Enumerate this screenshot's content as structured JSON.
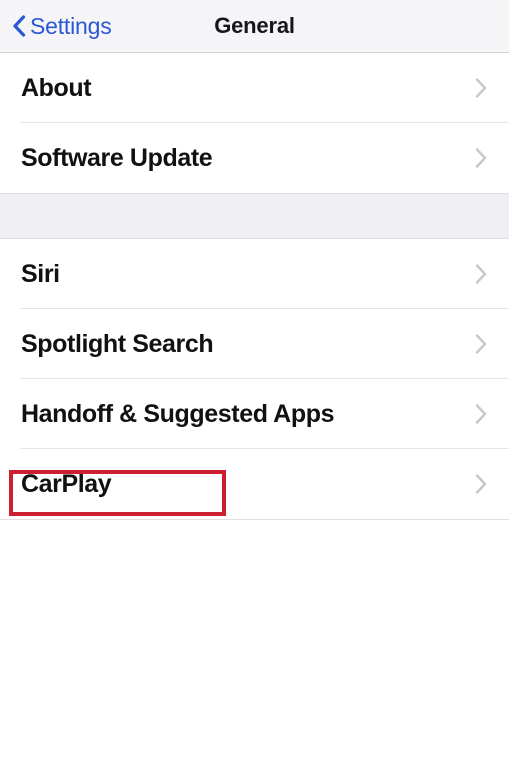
{
  "navbar": {
    "back_label": "Settings",
    "back_icon": "chevron-left-icon",
    "title": "General",
    "back_color": "#2B57D4",
    "background": "#F5F5F7"
  },
  "groups": [
    {
      "rows": [
        {
          "label": "About",
          "accessory": "chevron-right-icon"
        },
        {
          "label": "Software Update",
          "accessory": "chevron-right-icon"
        }
      ]
    },
    {
      "rows": [
        {
          "label": "Siri",
          "accessory": "chevron-right-icon"
        },
        {
          "label": "Spotlight Search",
          "accessory": "chevron-right-icon"
        },
        {
          "label": "Handoff & Suggested Apps",
          "accessory": "chevron-right-icon"
        },
        {
          "label": "CarPlay",
          "accessory": "chevron-right-icon"
        }
      ]
    }
  ],
  "annotation": {
    "target_label": "CarPlay",
    "color": "#CC2030"
  },
  "colors": {
    "group_background": "#EFEFF4",
    "row_background": "#FFFFFF",
    "separator": "#E6E6E9",
    "label_text": "#111114",
    "chevron": "#C6C6CB"
  }
}
